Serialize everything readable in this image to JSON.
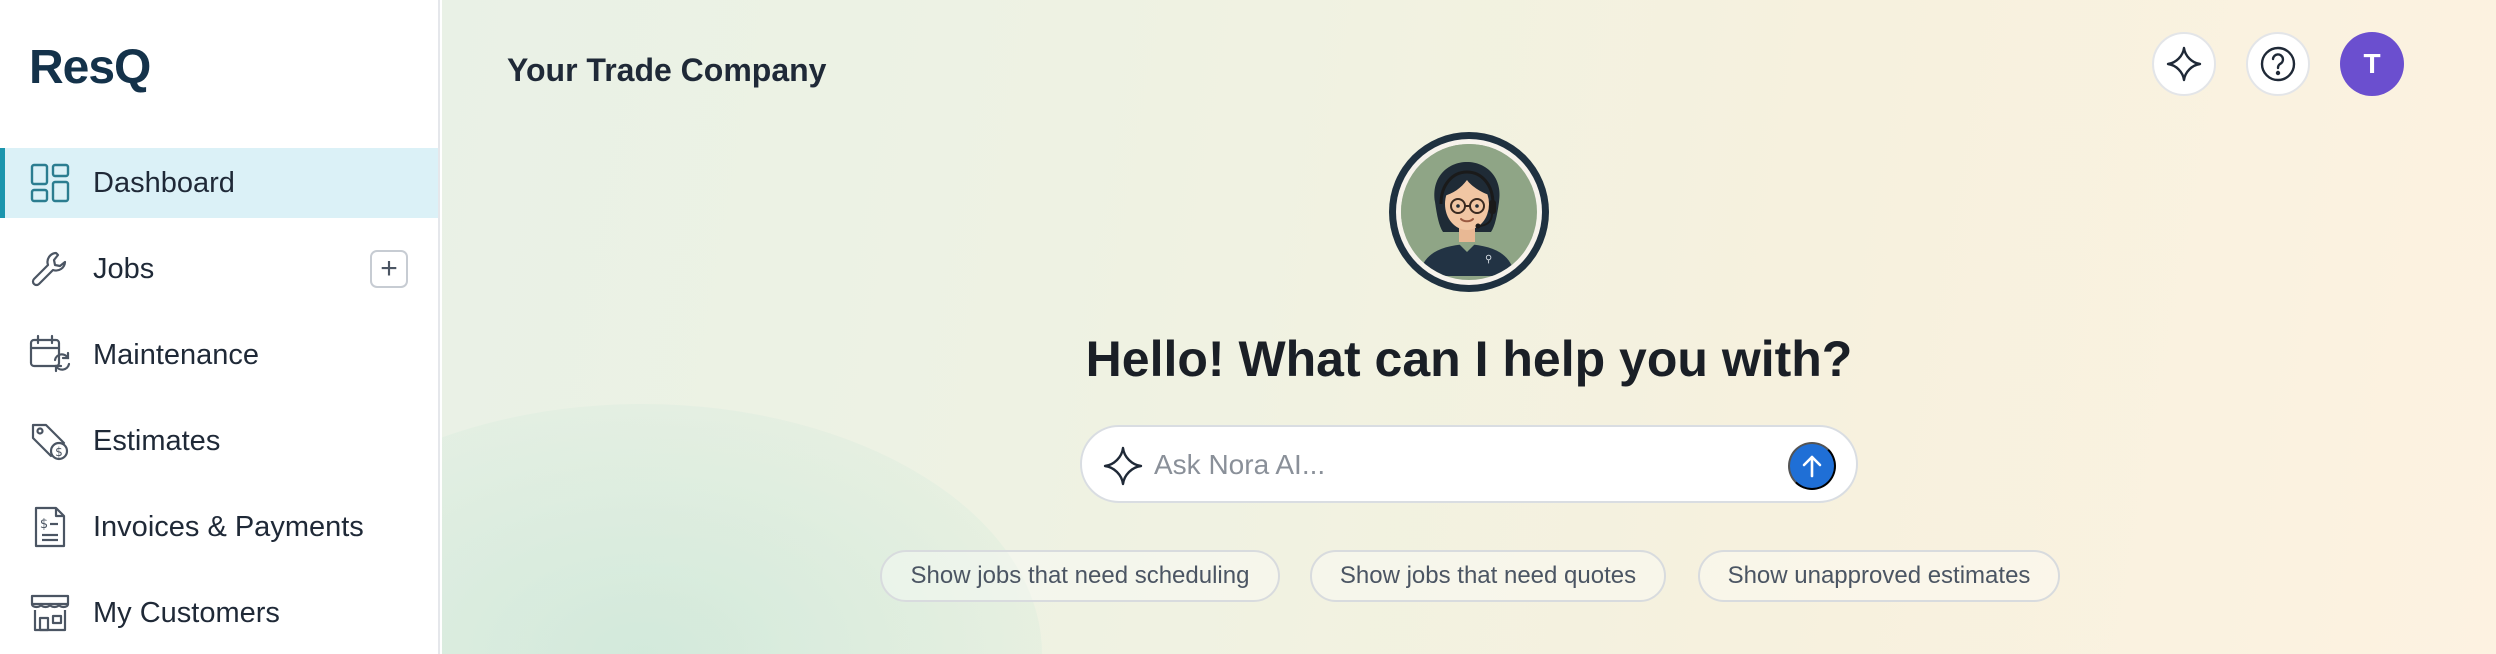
{
  "sidebar": {
    "logo": "ResQ",
    "items": [
      {
        "label": "Dashboard",
        "icon": "dashboard-icon"
      },
      {
        "label": "Jobs",
        "icon": "wrench-icon",
        "add": "+"
      },
      {
        "label": "Maintenance",
        "icon": "calendar-refresh-icon"
      },
      {
        "label": "Estimates",
        "icon": "price-tag-icon"
      },
      {
        "label": "Invoices & Payments",
        "icon": "invoice-icon"
      },
      {
        "label": "My Customers",
        "icon": "storefront-icon"
      }
    ]
  },
  "header": {
    "company": "Your Trade Company",
    "ai_icon": "sparkle-icon",
    "help_icon": "help-icon",
    "avatar_initial": "T"
  },
  "assistant": {
    "headline": "Hello! What can I help you with?",
    "placeholder": "Ask Nora AI...",
    "send_icon": "arrow-up-icon",
    "suggestions": [
      "Show jobs that need scheduling",
      "Show jobs that need quotes",
      "Show unapproved estimates"
    ]
  },
  "colors": {
    "brand": "#14324a",
    "active_bg": "#dbf1f7",
    "active_border": "#1b95ad",
    "avatar": "#6b4fcf",
    "send": "#1f6fd6"
  }
}
